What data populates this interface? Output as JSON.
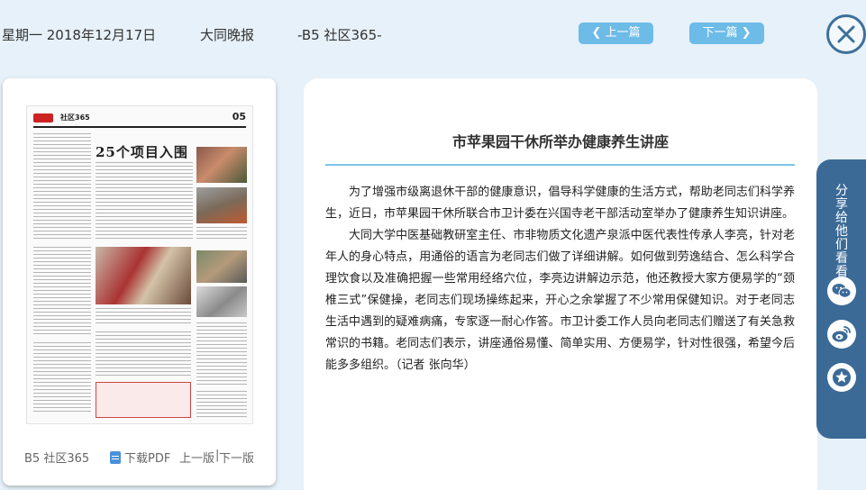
{
  "header": {
    "date": "星期一 2018年12月17日",
    "paper": "大同晚报",
    "page": "-B5 社区365-",
    "prev_article": "上一篇",
    "next_article": "下一篇"
  },
  "page_card": {
    "page_label": "B5 社区365",
    "download_pdf": "下载PDF",
    "prev_page": "上一版",
    "separator": "|",
    "next_page": "下一版"
  },
  "thumbnail": {
    "section": "社区365",
    "page_number": "05",
    "headline": "25个项目入围"
  },
  "article": {
    "title": "市苹果园干休所举办健康养生讲座",
    "paragraphs": [
      "为了增强市级离退休干部的健康意识，倡导科学健康的生活方式，帮助老同志们科学养生，近日，市苹果园干休所联合市卫计委在兴国寺老干部活动室举办了健康养生知识讲座。",
      "大同大学中医基础教研室主任、市非物质文化遗产泉派中医代表性传承人李亮，针对老年人的身心特点，用通俗的语言为老同志们做了详细讲解。如何做到劳逸结合、怎么科学合理饮食以及准确把握一些常用经络穴位，李亮边讲解边示范，他还教授大家方便易学的“颈椎三式”保健操，老同志们现场操练起来，开心之余掌握了不少常用保健知识。对于老同志生活中遇到的疑难病痛，专家逐一耐心作答。市卫计委工作人员向老同志们赠送了有关急救常识的书籍。老同志们表示，讲座通俗易懂、简单实用、方便易学，针对性很强，希望今后能多多组织。（记者 张向华）"
    ]
  },
  "share": {
    "label": "分享给他们看看"
  },
  "colors": {
    "accent": "#6dbbe7",
    "share_bar": "#3b6a97",
    "divider": "#7dc3e6",
    "background": "#e6f1f9"
  }
}
